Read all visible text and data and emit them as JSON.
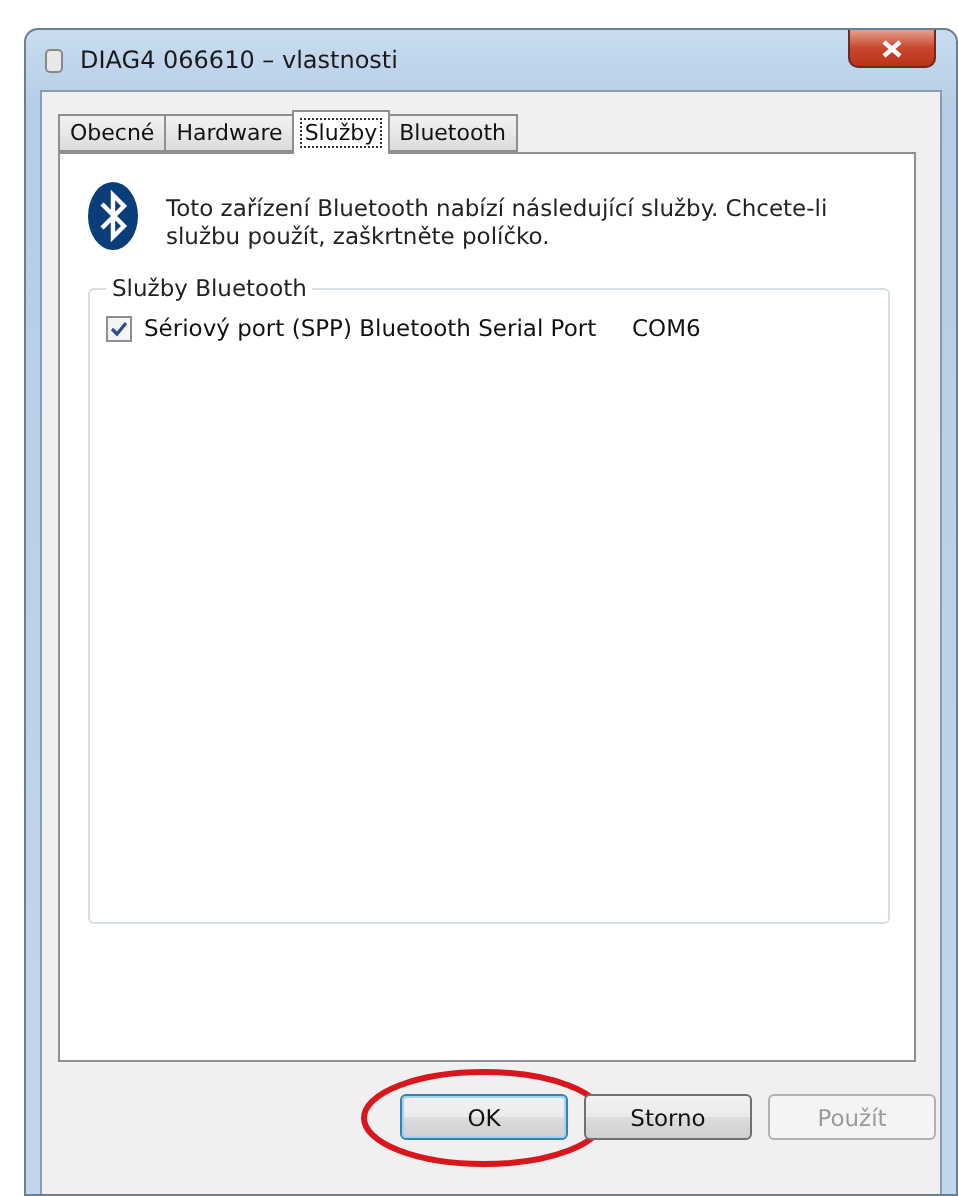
{
  "window": {
    "title": "DIAG4 066610 – vlastnosti"
  },
  "tabs": [
    {
      "label": "Obecné",
      "selected": false
    },
    {
      "label": "Hardware",
      "selected": false
    },
    {
      "label": "Služby",
      "selected": true
    },
    {
      "label": "Bluetooth",
      "selected": false
    }
  ],
  "intro": "Toto zařízení Bluetooth nabízí následující služby. Chcete-li službu použít, zaškrtněte políčko.",
  "group": {
    "title": "Služby Bluetooth",
    "services": [
      {
        "name": "Sériový port (SPP) Bluetooth Serial Port",
        "port": "COM6",
        "checked": true
      }
    ]
  },
  "buttons": [
    {
      "label": "OK",
      "disabled": false,
      "highlighted": true
    },
    {
      "label": "Storno",
      "disabled": false,
      "highlighted": false
    },
    {
      "label": "Použít",
      "disabled": true,
      "highlighted": false
    }
  ]
}
